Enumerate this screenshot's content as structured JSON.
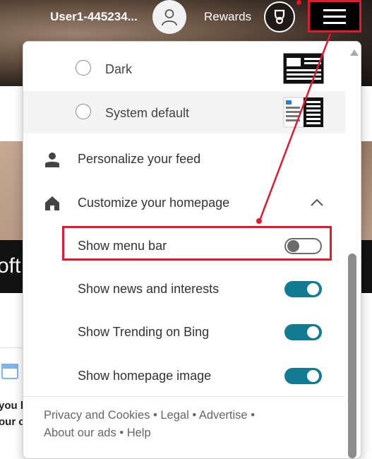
{
  "header": {
    "username": "User1-445234...",
    "rewards_label": "Rewards",
    "icons": {
      "avatar": "person-icon",
      "rewards": "trophy-icon",
      "menu": "hamburger-menu-icon"
    }
  },
  "background": {
    "partial_text": "oft",
    "lines": [
      "you l",
      "our c"
    ]
  },
  "panel": {
    "themes": [
      {
        "label": "Dark",
        "selected": false
      },
      {
        "label": "System default",
        "selected": false
      }
    ],
    "personalize": {
      "label": "Personalize your feed",
      "icon": "person-icon"
    },
    "customize": {
      "label": "Customize your homepage",
      "icon": "home-icon",
      "expanded": true
    },
    "toggles": [
      {
        "label": "Show menu bar",
        "on": false
      },
      {
        "label": "Show news and interests",
        "on": true
      },
      {
        "label": "Show Trending on Bing",
        "on": true
      },
      {
        "label": "Show homepage image",
        "on": true
      }
    ],
    "footer": {
      "privacy": "Privacy and Cookies",
      "legal": "Legal",
      "advertise": "Advertise",
      "about_ads": "About our ads",
      "help": "Help",
      "separator": "•"
    }
  },
  "colors": {
    "toggle_on": "#127a91",
    "annotation": "#e3192d"
  }
}
